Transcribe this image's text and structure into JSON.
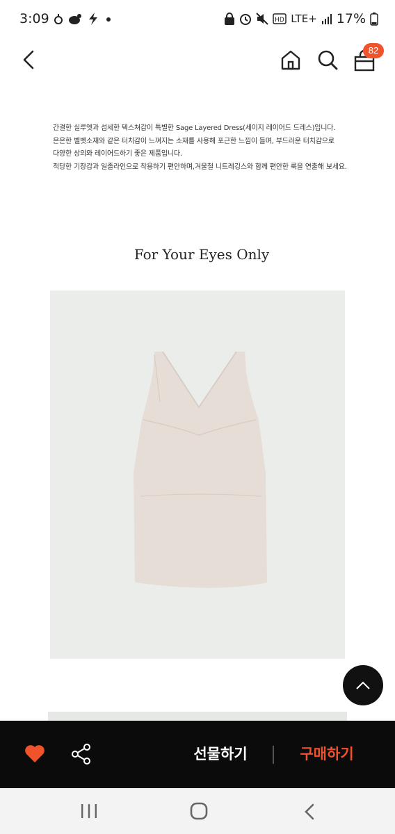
{
  "status_bar": {
    "time": "3:09",
    "network": "LTE+",
    "battery": "17%",
    "left_icons": [
      "face-icon",
      "coffee-icon",
      "bolt-icon",
      "dot-icon"
    ],
    "right_icons": [
      "lock-icon",
      "alarm-icon",
      "mute-icon",
      "hd-icon",
      "signal-icon",
      "battery-icon"
    ]
  },
  "header": {
    "cart_count": "82",
    "icons": [
      "back-icon",
      "home-icon",
      "search-icon",
      "cart-icon"
    ]
  },
  "description": {
    "lines": [
      "간결한 실루엣과 섬세한 텍스쳐감이 특별한 Sage Layered Dress(세이지 레이어드 드레스)입니다.",
      "은은한 벨벳소재와 같은 터치감이 느껴지는 소재를 사용해 포근한 느낌이 들며, 부드러운 터치감으로",
      "다양한 상의와 레이어드하기 좋은 제품입니다.",
      "적당한 기장감과 일졸라인으로 착용하기 편안하며,겨울철 니트레깅스와 함께 편안한 룩을 연출해 보세요."
    ]
  },
  "section_title": "For Your Eyes Only",
  "action_bar": {
    "gift_label": "선물하기",
    "buy_label": "구매하기",
    "accent_color": "#f0532c"
  },
  "colors": {
    "accent": "#f0532c",
    "action_bar_bg": "#0b0b0b",
    "photo_bg": "#eaedea",
    "dress": "#e6ddd6"
  }
}
